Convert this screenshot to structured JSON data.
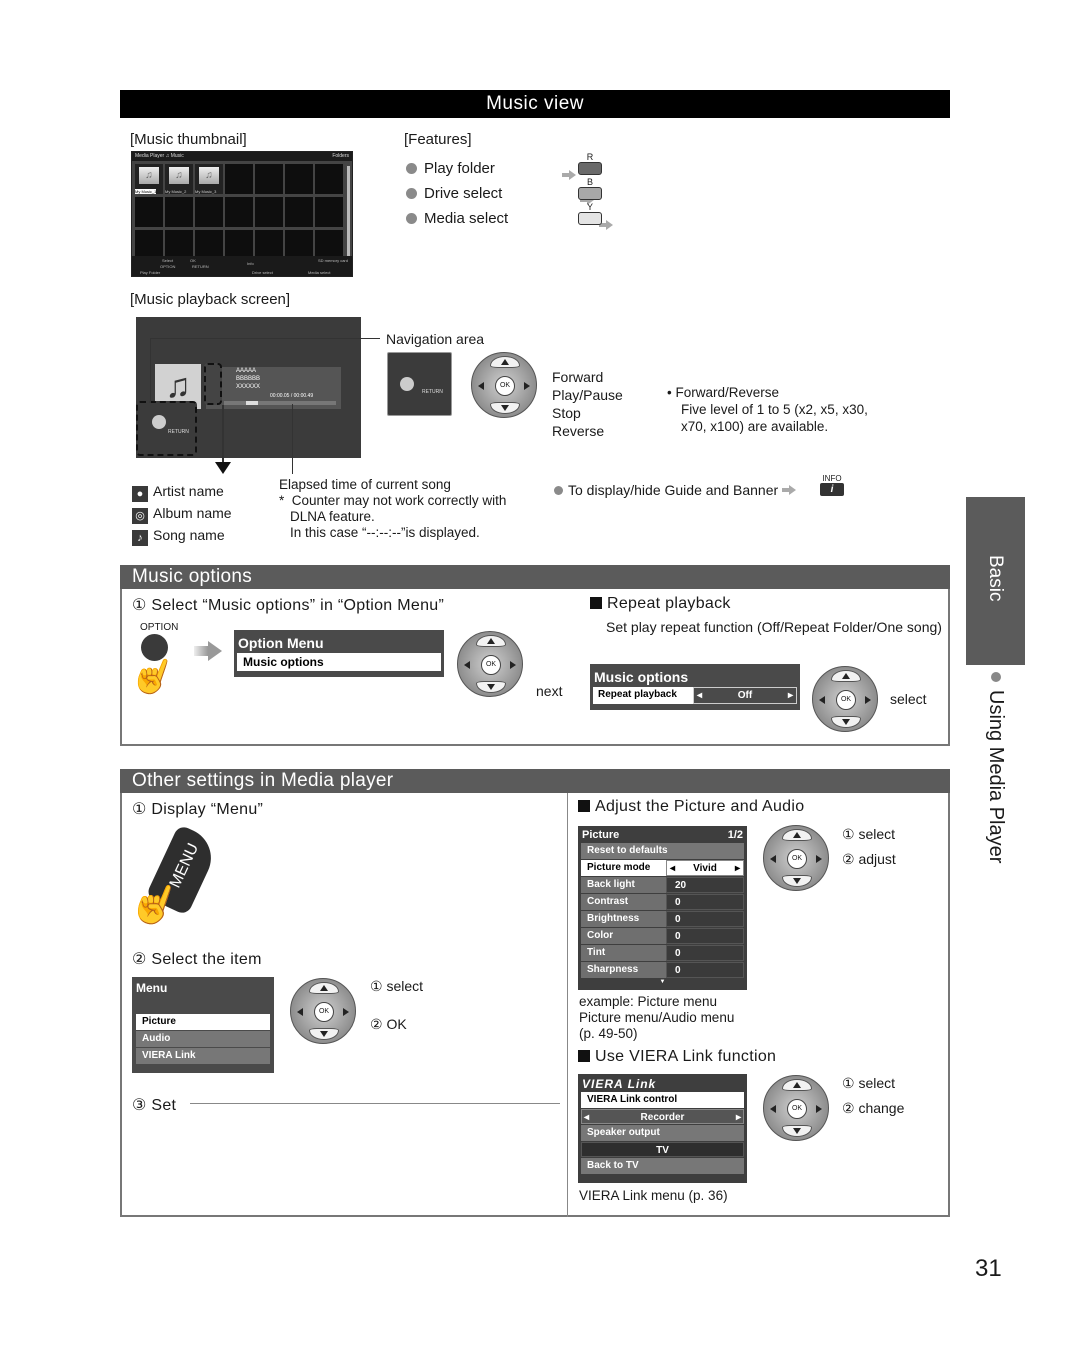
{
  "page_number": "31",
  "side_tab": {
    "section": "Basic",
    "chapter": "Using Media Player"
  },
  "music_view": {
    "title": "Music view",
    "thumbnail_label": "[Music thumbnail]",
    "thumbnail_screen": {
      "header_left": "Media Player",
      "header_mid": "Music",
      "header_right": "Folders",
      "items": [
        "My Music_1",
        "My Music_2",
        "My Music_3"
      ],
      "footer": {
        "select": "Select",
        "ok": "OK",
        "option": "OPTION",
        "return": "RETURN",
        "info": "Info",
        "storage": "SD memory card",
        "play_folder": "Play Folder",
        "drive_select": "Drive select",
        "media_select": "Media select"
      }
    },
    "features_label": "[Features]",
    "features": [
      {
        "label": "Play folder",
        "button": "R",
        "color": "#6a6a6a"
      },
      {
        "label": "Drive select",
        "button": "B",
        "color": "#a8a8a8"
      },
      {
        "label": "Media select",
        "button": "Y",
        "color": "#e4e4e4"
      }
    ],
    "playback_label": "[Music playback screen]",
    "playback_screen": {
      "song": "AAAAA",
      "album": "BBBBBB",
      "artist": "XXXXXX",
      "time": "00:00.05 / 00:00.49",
      "return": "RETURN"
    },
    "navigation_area_label": "Navigation area",
    "nav_return": "RETURN",
    "ok_label": "OK",
    "controls": [
      "Forward",
      "Play/Pause",
      "Stop",
      "Reverse"
    ],
    "ffrev_note": {
      "title": "Forward/Reverse",
      "body": "Five level of 1 to 5 (x2, x5, x30, x70, x100) are available."
    },
    "legend": [
      {
        "icon": "artist-icon",
        "label": "Artist name"
      },
      {
        "icon": "album-icon",
        "label": "Album name"
      },
      {
        "icon": "song-icon",
        "label": "Song name"
      }
    ],
    "elapsed_note": {
      "title": "Elapsed time of current song",
      "star": "*",
      "line1": "Counter may not work correctly with",
      "line2": "DLNA feature.",
      "line3": "In this case “--:--:--”is displayed."
    },
    "guide_note": "To display/hide Guide and Banner",
    "info_label": "INFO"
  },
  "music_options": {
    "title": "Music options",
    "step1": "① Select “Music options” in “Option Menu”",
    "option_button_label": "OPTION",
    "option_menu": {
      "title": "Option Menu",
      "item": "Music options"
    },
    "next_label": "next",
    "repeat": {
      "heading": "Repeat playback",
      "description": "Set play repeat function (Off/Repeat Folder/One song)",
      "menu_title": "Music options",
      "row_label": "Repeat playback",
      "row_value": "Off",
      "select_label": "select"
    }
  },
  "other_settings": {
    "title": "Other settings in Media player",
    "step1": "① Display “Menu”",
    "menu_button_label": "MENU",
    "step2": "② Select the item",
    "menu": {
      "title": "Menu",
      "items": [
        "Picture",
        "Audio",
        "VIERA Link"
      ]
    },
    "step2_select": "① select",
    "step2_ok": "② OK",
    "step3": "③ Set",
    "adjust": {
      "heading": "Adjust the Picture and Audio",
      "menu_title": "Picture",
      "page": "1/2",
      "reset": "Reset to defaults",
      "rows": [
        {
          "label": "Picture mode",
          "value": "Vivid"
        },
        {
          "label": "Back light",
          "value": "20"
        },
        {
          "label": "Contrast",
          "value": "0"
        },
        {
          "label": "Brightness",
          "value": "0"
        },
        {
          "label": "Color",
          "value": "0"
        },
        {
          "label": "Tint",
          "value": "0"
        },
        {
          "label": "Sharpness",
          "value": "0"
        }
      ],
      "select_label": "① select",
      "adjust_label": "② adjust",
      "caption1": "example: Picture menu",
      "caption2": "Picture menu/Audio menu",
      "caption3": "(p. 49-50)"
    },
    "viera": {
      "heading": "Use VIERA Link function",
      "menu_title": "VIERA Link",
      "control_label": "VIERA Link control",
      "control_value": "Recorder",
      "speaker_label": "Speaker output",
      "speaker_value": "TV",
      "back_label": "Back to TV",
      "select_label": "① select",
      "change_label": "② change",
      "caption": "VIERA Link menu (p. 36)"
    }
  }
}
